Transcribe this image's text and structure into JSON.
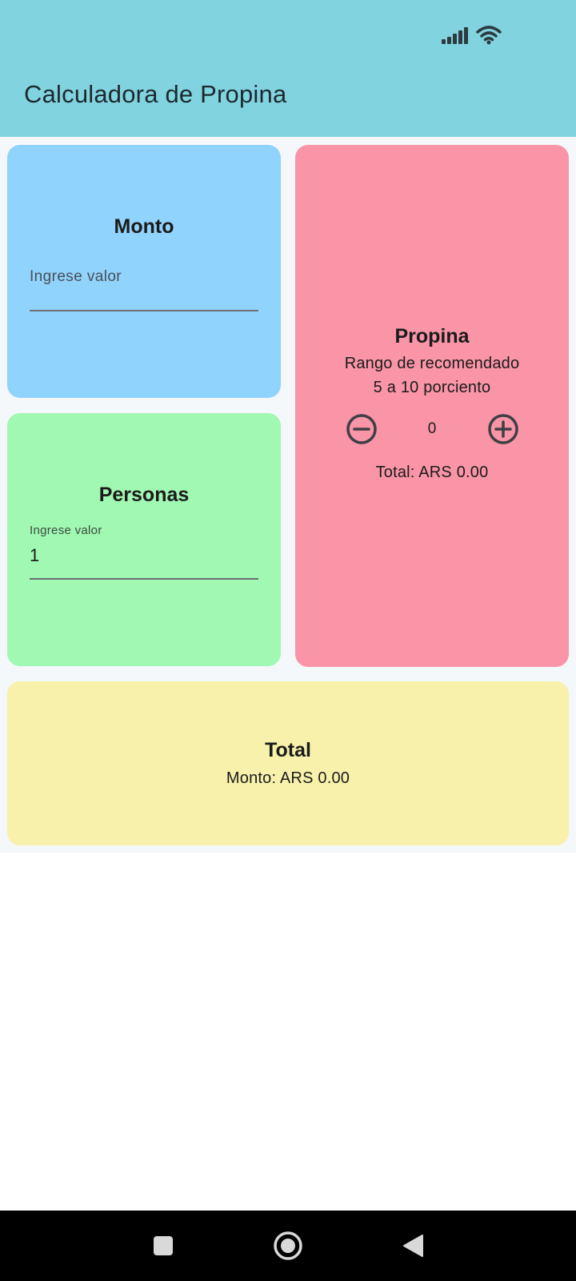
{
  "status_bar": {
    "icons": [
      "signal-icon",
      "wifi-icon"
    ]
  },
  "app_bar": {
    "title": "Calculadora de Propina"
  },
  "monto_card": {
    "heading": "Monto",
    "input_placeholder": "Ingrese valor",
    "input_value": ""
  },
  "personas_card": {
    "heading": "Personas",
    "input_label": "Ingrese valor",
    "input_value": "1"
  },
  "propina_card": {
    "heading": "Propina",
    "line1": "Rango de recomendado",
    "line2": "5 a 10 porciento",
    "stepper_value": "0",
    "total_text": "Total: ARS 0.00",
    "icons": [
      "minus-circle-icon",
      "plus-circle-icon"
    ]
  },
  "total_card": {
    "heading": "Total",
    "amount_text": "Monto: ARS 0.00"
  },
  "nav_bar": {
    "buttons": [
      "recents-square-icon",
      "home-circle-icon",
      "back-triangle-icon"
    ]
  },
  "colors": {
    "app_bar": "#82d3e0",
    "monto_card": "#90d3fd",
    "personas_card": "#a0f8b2",
    "propina_card": "#f995a6",
    "total_card": "#f8f1ab"
  }
}
